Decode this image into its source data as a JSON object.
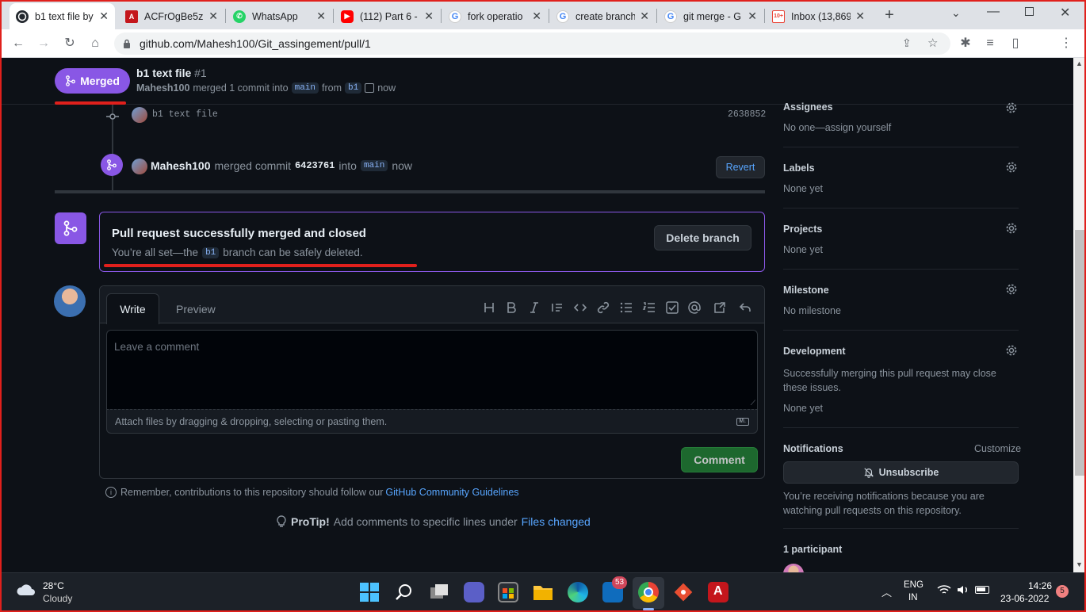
{
  "browser": {
    "tabs": [
      {
        "title": "b1 text file by",
        "active": true,
        "icon": "github-icon"
      },
      {
        "title": "ACFrOgBe5z",
        "icon": "pdf-icon"
      },
      {
        "title": "WhatsApp",
        "icon": "whatsapp-icon"
      },
      {
        "title": "(112) Part 6 -",
        "icon": "youtube-icon"
      },
      {
        "title": "fork operatio",
        "icon": "google-icon"
      },
      {
        "title": "create branch",
        "icon": "google-icon"
      },
      {
        "title": "git merge - G",
        "icon": "google-icon"
      },
      {
        "title": "Inbox (13,869",
        "icon": "gmail-icon",
        "badge": "10+"
      }
    ],
    "url": "github.com/Mahesh100/Git_assingement/pull/1"
  },
  "pr": {
    "state": "Merged",
    "title": "b1 text file",
    "number": "#1",
    "author": "Mahesh100",
    "meta_merged": "merged 1 commit into",
    "base": "main",
    "meta_from": "from",
    "head": "b1",
    "time": "now"
  },
  "timeline": {
    "commit_msg": "b1 text file",
    "commit_sha": "2638852",
    "merge_user": "Mahesh100",
    "merge_text": "merged commit",
    "merge_sha": "6423761",
    "merge_into": "into",
    "merge_base": "main",
    "merge_time": "now",
    "revert": "Revert"
  },
  "merge_box": {
    "title": "Pull request successfully merged and closed",
    "desc_pre": "You’re all set—the",
    "branch": "b1",
    "desc_post": "branch can be safely deleted.",
    "delete_btn": "Delete branch"
  },
  "comment": {
    "tab_write": "Write",
    "tab_preview": "Preview",
    "placeholder": "Leave a comment",
    "attach": "Attach files by dragging & dropping, selecting or pasting them.",
    "submit": "Comment",
    "remember": "Remember, contributions to this repository should follow our",
    "guidelines": "GitHub Community Guidelines",
    "protip_label": "ProTip!",
    "protip_text": "Add comments to specific lines under",
    "files_changed": "Files changed"
  },
  "sidebar": {
    "assignees_title": "Assignees",
    "assignees_val": "No one—assign yourself",
    "labels_title": "Labels",
    "labels_val": "None yet",
    "projects_title": "Projects",
    "projects_val": "None yet",
    "milestone_title": "Milestone",
    "milestone_val": "No milestone",
    "development_title": "Development",
    "development_desc": "Successfully merging this pull request may close these issues.",
    "development_val": "None yet",
    "notifications_title": "Notifications",
    "customize": "Customize",
    "unsubscribe": "Unsubscribe",
    "notifications_desc": "You’re receiving notifications because you are watching pull requests on this repository.",
    "participants": "1 participant"
  },
  "taskbar": {
    "temp": "28°C",
    "weather": "Cloudy",
    "store_badge": "53",
    "lang1": "ENG",
    "lang2": "IN",
    "time": "14:26",
    "date": "23-06-2022",
    "notif_count": "5"
  },
  "colors": {
    "merged": "#8957e5",
    "accent_link": "#58a6ff",
    "comment_btn": "#238636",
    "annotation": "#e0201c"
  }
}
